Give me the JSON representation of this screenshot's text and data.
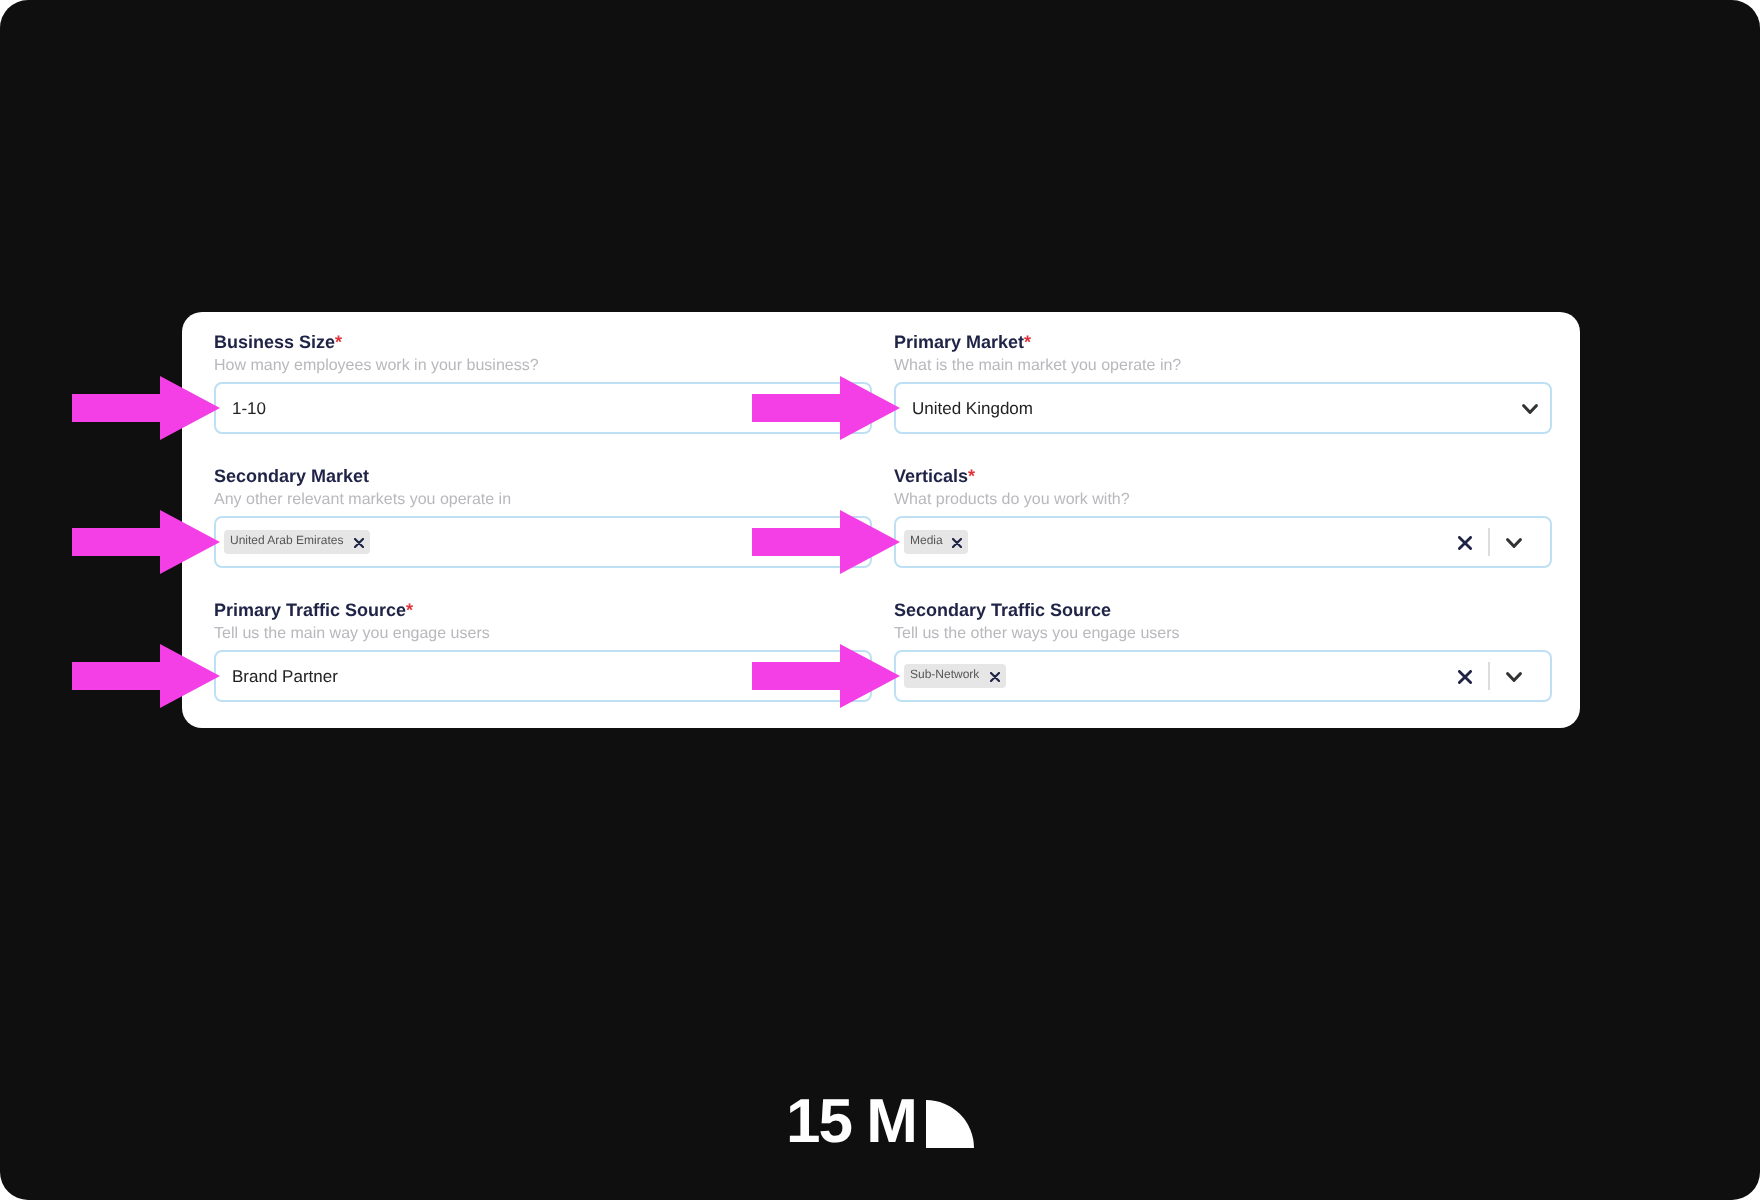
{
  "form": {
    "fields": [
      {
        "kind": "text",
        "label": "Business Size",
        "required_mark": "*",
        "hint": "How many employees work in your business?",
        "value": "1-10",
        "arrow": true
      },
      {
        "kind": "select",
        "label": "Primary Market",
        "required_mark": "*",
        "hint": "What is the main market you operate in?",
        "value": "United Kingdom",
        "arrow": true
      },
      {
        "kind": "tags",
        "label": "Secondary Market",
        "hint": "Any other relevant markets you operate in",
        "tags": [
          "United Arab Emirates"
        ],
        "indicators": false,
        "arrow": true
      },
      {
        "kind": "tags",
        "label": "Verticals",
        "required_mark": "*",
        "hint": "What products do you work with?",
        "tags": [
          "Media"
        ],
        "indicators": true,
        "arrow": true
      },
      {
        "kind": "text",
        "label": "Primary Traffic Source",
        "required_mark": "*",
        "hint": "Tell us the main way you engage users",
        "value": "Brand Partner",
        "arrow": true
      },
      {
        "kind": "tags",
        "label": "Secondary Traffic Source",
        "hint": "Tell us the other ways you engage users",
        "tags": [
          "Sub-Network"
        ],
        "indicators": true,
        "arrow": true
      }
    ]
  },
  "logo": {
    "text": "15 M"
  }
}
